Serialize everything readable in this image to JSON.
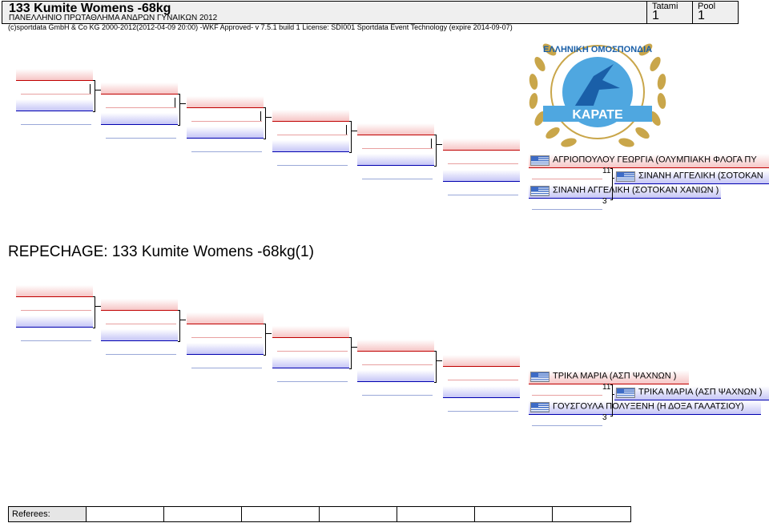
{
  "header": {
    "title": "133 Kumite Womens -68kg",
    "subtitle": "ΠΑΝΕΛΛΗΝΙΟ ΠΡΩΤΑΘΛΗΜΑ ΑΝΔΡΩΝ ΓΥΝΑΙΚΩΝ 2012",
    "tatami_label": "Tatami",
    "tatami_value": "1",
    "pool_label": "Pool",
    "pool_value": "1"
  },
  "copyright": "(c)sportdata GmbH & Co KG 2000-2012(2012-04-09 20:00) -WKF Approved- v 7.5.1 build 1 License: SDI001 Sportdata Event Technology (expire 2014-09-07)",
  "logo": {
    "arc_text": "ΕΛΛΗΝΙΚΗ ΟΜΟΣΠΟΝΔΙΑ",
    "word": "ΚΑΡΑΤΕ",
    "colors": {
      "laurel": "#c9a64a",
      "globe": "#4fa7e0",
      "figure": "#1a5fa8"
    }
  },
  "main": {
    "finalists": [
      {
        "name": "ΑΓΡΙΟΠΟΥΛΟΥ ΓΕΩΡΓΙΑ (ΟΛΥΜΠΙΑΚΗ ΦΛΟΓΑ ΠΥ",
        "color": "red"
      },
      {
        "name": "ΣΙΝΑΝΗ ΑΓΓΕΛΙΚΗ (ΣΟΤΟΚΑΝ  ΧΑΝΙΩΝ )",
        "color": "blue"
      }
    ],
    "winner": "ΣΙΝΑΝΗ ΑΓΓΕΛΙΚΗ (ΣΟΤΟΚΑΝ",
    "score_top": "11",
    "score_bottom": "3"
  },
  "repechage": {
    "heading": "REPECHAGE:   133 Kumite Womens -68kg(1)",
    "finalists": [
      {
        "name": "ΤΡΙΚΑ ΜΑΡΙΑ (ΑΣΠ ΨΑΧΝΩΝ )",
        "color": "red"
      },
      {
        "name": "ΓΟΥΣΓΟΥΛΑ ΠΟΛΥΞΕΝΗ (Η ΔΟΞΑ  ΓΑΛΑΤΣΙΟΥ)",
        "color": "blue"
      }
    ],
    "winner": "ΤΡΙΚΑ ΜΑΡΙΑ (ΑΣΠ ΨΑΧΝΩΝ )",
    "score_top": "11",
    "score_bottom": "3"
  },
  "referees": {
    "label": "Referees:"
  }
}
